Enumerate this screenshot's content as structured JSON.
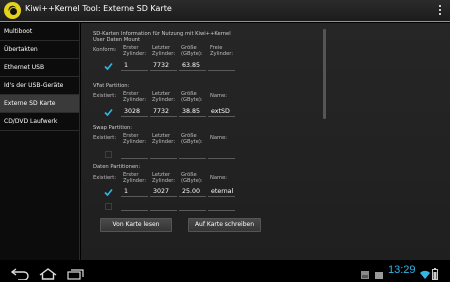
{
  "window": {
    "title": "Kiwi++Kernel Tool: Externe SD Karte"
  },
  "sidebar": {
    "items": [
      {
        "label": "Multiboot"
      },
      {
        "label": "Übertakten"
      },
      {
        "label": "Ethernet USB"
      },
      {
        "label": "Id's der USB-Geräte"
      },
      {
        "label": "Externe SD Karte"
      },
      {
        "label": "CD/DVD Laufwerk"
      }
    ],
    "active_index": 4
  },
  "sd_info": {
    "title": "SD-Karten Information für Nutzung mit Kiwi++Kernel",
    "user_data_mount": "User Daten Mount",
    "konform_label": "Konform:",
    "col_first": [
      "Erster",
      "Zylinder:"
    ],
    "col_last": [
      "Letzter",
      "Zylinder:"
    ],
    "col_size": [
      "Größe",
      "(GByte):"
    ],
    "col_free": [
      "Freie",
      "Zylinder:"
    ],
    "row": {
      "first": "1",
      "last": "7732",
      "size": "63.85",
      "free": ""
    },
    "konform_checked": true
  },
  "vfat": {
    "title": "VFat Partition:",
    "exists_label": "Existiert:",
    "col_name": "Name:",
    "row": {
      "first": "3028",
      "last": "7732",
      "size": "38.85",
      "name": "extSD"
    },
    "exists_checked": true
  },
  "swap": {
    "title": "Swap Partition:",
    "exists_label": "Existiert:",
    "col_name": "Name:",
    "row": {
      "first": "",
      "last": "",
      "size": "",
      "name": ""
    },
    "exists_checked": false
  },
  "data": {
    "title": "Daten Partitionen:",
    "exists_label": "Existiert:",
    "col_name": "Name:",
    "rows": [
      {
        "first": "1",
        "last": "3027",
        "size": "25.00",
        "name": "eternal",
        "checked": true
      },
      {
        "first": "",
        "last": "",
        "size": "",
        "name": "",
        "checked": false
      }
    ]
  },
  "buttons": {
    "read": "Von Karte lesen",
    "write": "Auf Karte schreiben"
  },
  "statusbar": {
    "time": "13:29"
  },
  "colors": {
    "accent": "#33b5e5",
    "check": "#33b5e5"
  }
}
